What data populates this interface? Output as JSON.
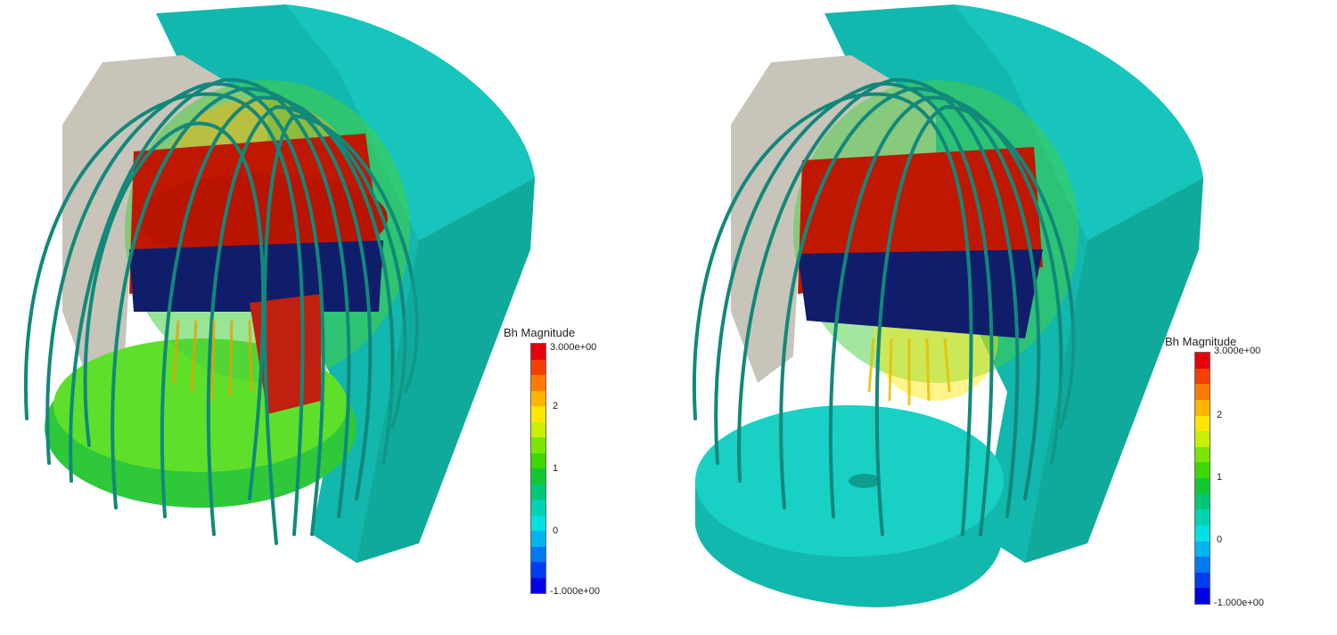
{
  "views": [
    {
      "name": "left-view",
      "legend": {
        "title": "Bh Magnitude",
        "max_label": "3.000e+00",
        "min_label": "-1.000e+00",
        "ticks": [
          "2",
          "1",
          "0"
        ]
      }
    },
    {
      "name": "right-view",
      "legend": {
        "title": "Bh Magnitude",
        "max_label": "3.000e+00",
        "min_label": "-1.000e+00",
        "ticks": [
          "2",
          "1",
          "0"
        ]
      }
    }
  ],
  "colormap": [
    "#e6000b",
    "#f24000",
    "#ff7a00",
    "#ffb400",
    "#ffe600",
    "#c8f000",
    "#78e600",
    "#3cd800",
    "#12c832",
    "#00c878",
    "#00d2b4",
    "#00e1e1",
    "#00b4f0",
    "#0078f0",
    "#003cf0",
    "#0000e6"
  ],
  "colors": {
    "shell": "#12b7ad",
    "shell_light": "#19d0c5",
    "grey": "#c8c4ba",
    "coil_red": "#c01800",
    "band_dark": "#101d6b",
    "green": "#2ec83a",
    "line": "#11887a"
  }
}
